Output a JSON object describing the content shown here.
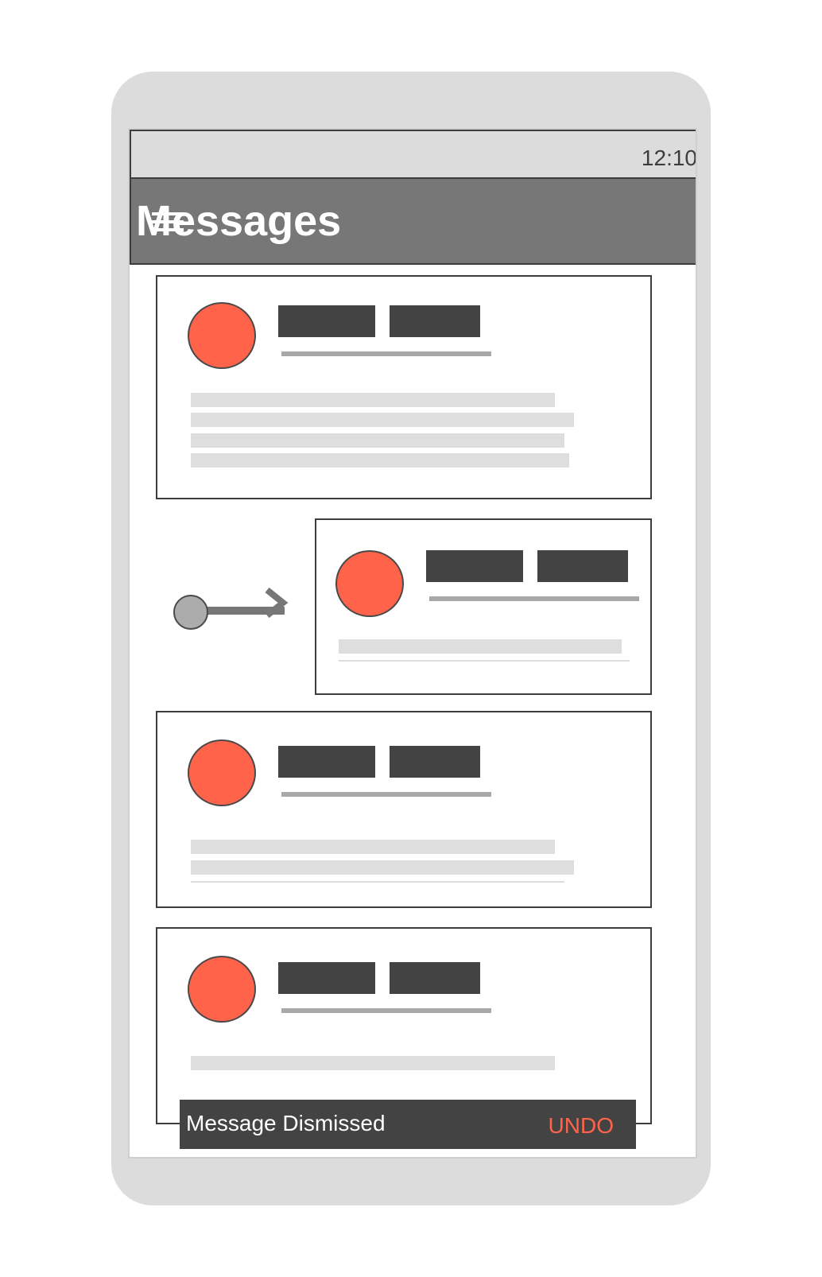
{
  "status_bar": {
    "time": "12:10"
  },
  "app_bar": {
    "title": "Messages",
    "menu_icon": "hamburger-menu-icon"
  },
  "messages": [
    {
      "state": "default",
      "preview_lines": 4
    },
    {
      "state": "swiping",
      "preview_lines": 2
    },
    {
      "state": "default",
      "preview_lines": 3
    },
    {
      "state": "default",
      "preview_lines": 1
    }
  ],
  "gesture": {
    "icon": "swipe-right-icon"
  },
  "snackbar": {
    "message": "Message Dismissed",
    "action": "UNDO"
  },
  "colors": {
    "accent": "#ff644b",
    "app_bar": "#777777",
    "placeholder_dark": "#434343",
    "placeholder_light": "#dedede",
    "device": "#dcdcdc"
  }
}
